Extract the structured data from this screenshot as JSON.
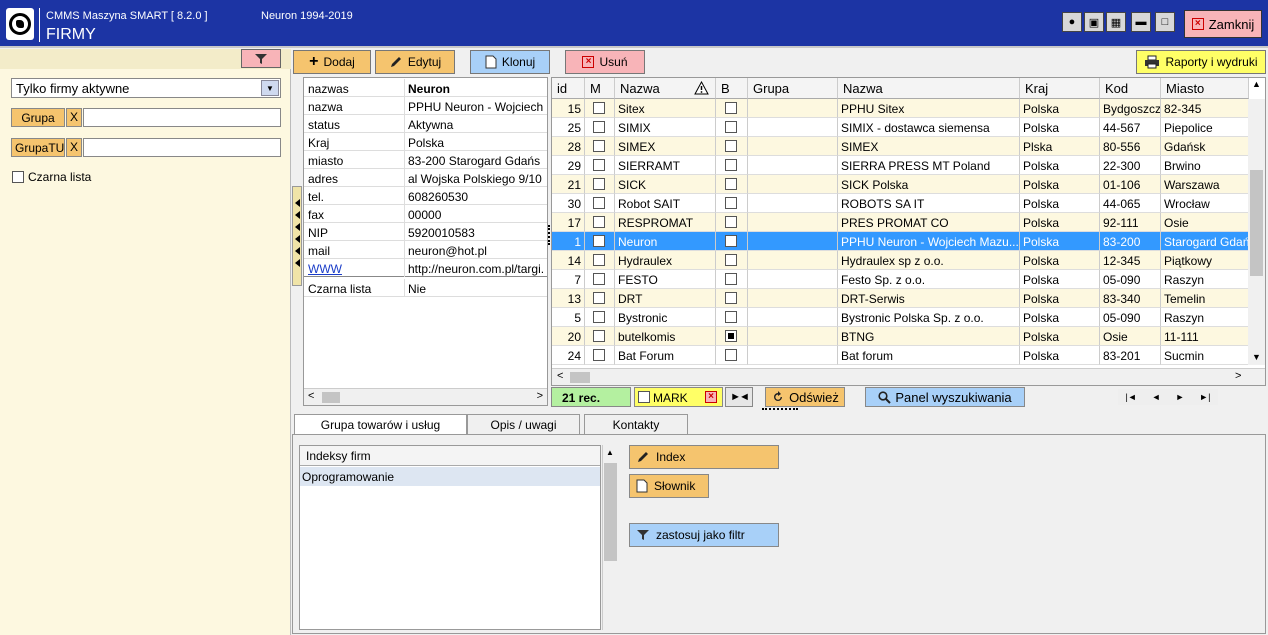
{
  "header": {
    "app_title": "CMMS Maszyna SMART  [  8.2.0 ]",
    "copyright": "Neuron 1994-2019",
    "screen_title": "FIRMY",
    "close_label": "Zamknij"
  },
  "filters": {
    "status_value": "Tylko firmy aktywne",
    "group_label": "Grupa",
    "group_tu_label": "GrupaTU",
    "clear_label": "X",
    "blacklist_label": "Czarna lista"
  },
  "toolbar": {
    "add": "Dodaj",
    "edit": "Edytuj",
    "clone": "Klonuj",
    "delete": "Usuń",
    "reports": "Raporty i wydruki"
  },
  "detail": {
    "rows": [
      {
        "key": "nazwas",
        "value": "Neuron"
      },
      {
        "key": "nazwa",
        "value": "PPHU Neuron - Wojciech"
      },
      {
        "key": "status",
        "value": "Aktywna"
      },
      {
        "key": "Kraj",
        "value": "Polska"
      },
      {
        "key": "miasto",
        "value": "83-200 Starogard Gdańs"
      },
      {
        "key": "adres",
        "value": "al Wojska Polskiego 9/10"
      },
      {
        "key": "tel.",
        "value": "608260530"
      },
      {
        "key": "fax",
        "value": "00000"
      },
      {
        "key": "NIP",
        "value": "5920010583"
      },
      {
        "key": "mail",
        "value": "neuron@hot.pl"
      },
      {
        "key": "WWW",
        "value": "http://neuron.com.pl/targi."
      }
    ],
    "blacklist": {
      "key": "Czarna lista",
      "value": "Nie"
    }
  },
  "grid": {
    "columns": [
      "id",
      "M",
      "Nazwa",
      "B",
      "Grupa",
      "Nazwa",
      "Kraj",
      "Kod",
      "Miasto"
    ],
    "rows": [
      {
        "id": "15",
        "m": false,
        "nazwa": "Sitex",
        "b": false,
        "grupa": "",
        "nazwa2": "PPHU Sitex",
        "kraj": "Polska",
        "kod": "Bydgoszcz",
        "miasto": "82-345"
      },
      {
        "id": "25",
        "m": false,
        "nazwa": "SIMIX",
        "b": false,
        "grupa": "",
        "nazwa2": "SIMIX - dostawca siemensa",
        "kraj": "Polska",
        "kod": "44-567",
        "miasto": "Piepolice"
      },
      {
        "id": "28",
        "m": false,
        "nazwa": "SIMEX",
        "b": false,
        "grupa": "",
        "nazwa2": "SIMEX",
        "kraj": "Plska",
        "kod": "80-556",
        "miasto": "Gdańsk"
      },
      {
        "id": "29",
        "m": false,
        "nazwa": "SIERRAMT",
        "b": false,
        "grupa": "",
        "nazwa2": "SIERRA PRESS MT Poland",
        "kraj": "Polska",
        "kod": "22-300",
        "miasto": "Brwino"
      },
      {
        "id": "21",
        "m": false,
        "nazwa": "SICK",
        "b": false,
        "grupa": "",
        "nazwa2": "SICK Polska",
        "kraj": "Polska",
        "kod": "01-106",
        "miasto": "Warszawa"
      },
      {
        "id": "30",
        "m": false,
        "nazwa": "Robot SAIT",
        "b": false,
        "grupa": "",
        "nazwa2": "ROBOTS SA IT",
        "kraj": "Polska",
        "kod": "44-065",
        "miasto": "Wrocław"
      },
      {
        "id": "17",
        "m": false,
        "nazwa": "RESPROMAT",
        "b": false,
        "grupa": "",
        "nazwa2": "PRES PROMAT CO",
        "kraj": "Polska",
        "kod": "92-111",
        "miasto": "Osie"
      },
      {
        "id": "1",
        "m": false,
        "nazwa": "Neuron",
        "b": false,
        "grupa": "",
        "nazwa2": "PPHU Neuron - Wojciech Mazu...",
        "kraj": "Polska",
        "kod": "83-200",
        "miasto": "Starogard Gdań",
        "selected": true
      },
      {
        "id": "14",
        "m": false,
        "nazwa": "Hydraulex",
        "b": false,
        "grupa": "",
        "nazwa2": "Hydraulex sp z o.o.",
        "kraj": "Polska",
        "kod": "12-345",
        "miasto": "Piątkowy"
      },
      {
        "id": "7",
        "m": false,
        "nazwa": "FESTO",
        "b": false,
        "grupa": "",
        "nazwa2": "Festo Sp. z o.o.",
        "kraj": "Polska",
        "kod": "05-090",
        "miasto": "Raszyn"
      },
      {
        "id": "13",
        "m": false,
        "nazwa": "DRT",
        "b": false,
        "grupa": "",
        "nazwa2": "DRT-Serwis",
        "kraj": "Polska",
        "kod": "83-340",
        "miasto": "Temelin"
      },
      {
        "id": "5",
        "m": false,
        "nazwa": "Bystronic",
        "b": false,
        "grupa": "",
        "nazwa2": "Bystronic Polska Sp. z o.o.",
        "kraj": "Polska",
        "kod": "05-090",
        "miasto": " Raszyn"
      },
      {
        "id": "20",
        "m": false,
        "nazwa": "butelkomis",
        "b": true,
        "grupa": "",
        "nazwa2": "BTNG",
        "kraj": "Polska",
        "kod": "Osie",
        "miasto": "11-111"
      },
      {
        "id": "24",
        "m": false,
        "nazwa": "Bat Forum",
        "b": false,
        "grupa": "",
        "nazwa2": "Bat forum",
        "kraj": "Polska",
        "kod": "83-201",
        "miasto": "Sucmin"
      }
    ]
  },
  "status_strip": {
    "records": "21 rec.",
    "mark": "MARK",
    "refresh": "Odśwież",
    "search_panel": "Panel wyszukiwania"
  },
  "tabs": [
    "Grupa towarów i usług",
    "Opis / uwagi",
    "Kontakty"
  ],
  "bottom": {
    "list_header": "Indeksy firm",
    "list_items": [
      "Oprogramowanie"
    ],
    "index_btn": "Index",
    "dict_btn": "Słownik",
    "filter_btn": "zastosuj jako filtr"
  }
}
